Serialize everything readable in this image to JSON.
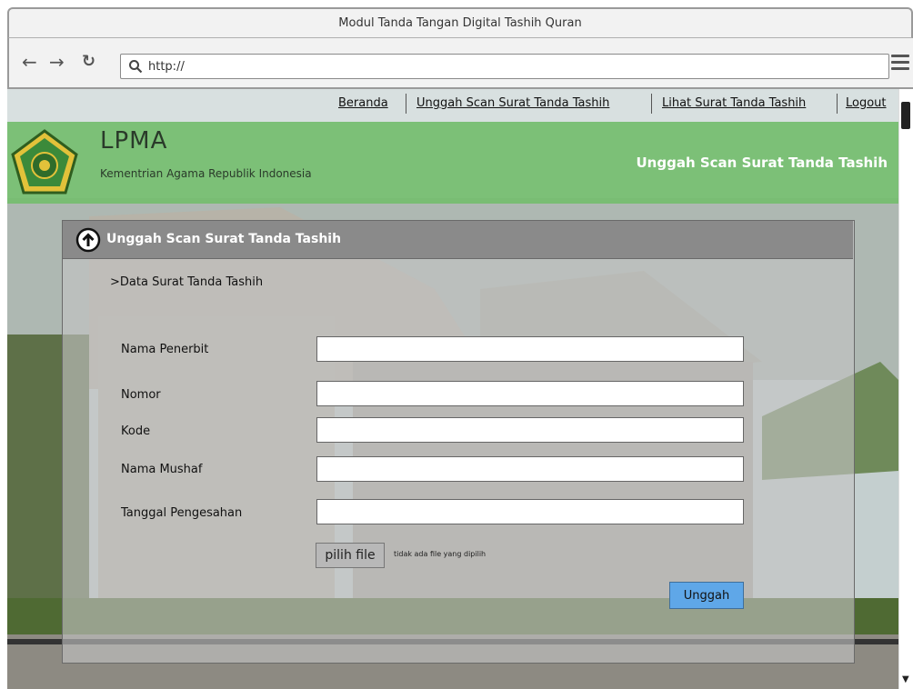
{
  "window": {
    "title": "Modul Tanda Tangan Digital Tashih Quran"
  },
  "browser": {
    "url": "http://",
    "icons": [
      "back-arrow-icon",
      "forward-arrow-icon",
      "reload-icon",
      "search-icon",
      "hamburger-menu-icon"
    ]
  },
  "nav": {
    "items": [
      {
        "label": "Beranda"
      },
      {
        "label": "Unggah Scan Surat Tanda Tashih"
      },
      {
        "label": "Lihat Surat Tanda Tashih"
      },
      {
        "label": "Logout"
      }
    ]
  },
  "header": {
    "brand": "LPMA",
    "subtitle": "Kementrian Agama Republik Indonesia",
    "page_title": "Unggah Scan Surat Tanda Tashih",
    "color": "#70bd67"
  },
  "form": {
    "title": "Unggah Scan Surat Tanda Tashih",
    "section": ">Data Surat Tanda Tashih",
    "fields": [
      {
        "label": "Nama Penerbit",
        "value": ""
      },
      {
        "label": "Nomor",
        "value": ""
      },
      {
        "label": "Kode",
        "value": ""
      },
      {
        "label": "Nama Mushaf",
        "value": ""
      },
      {
        "label": "Tanggal Pengesahan",
        "value": ""
      }
    ],
    "file_button": "pilih file",
    "file_status": "tidak ada file yang dipilih",
    "submit": "Unggah",
    "submit_color": "#5fa7e8"
  }
}
